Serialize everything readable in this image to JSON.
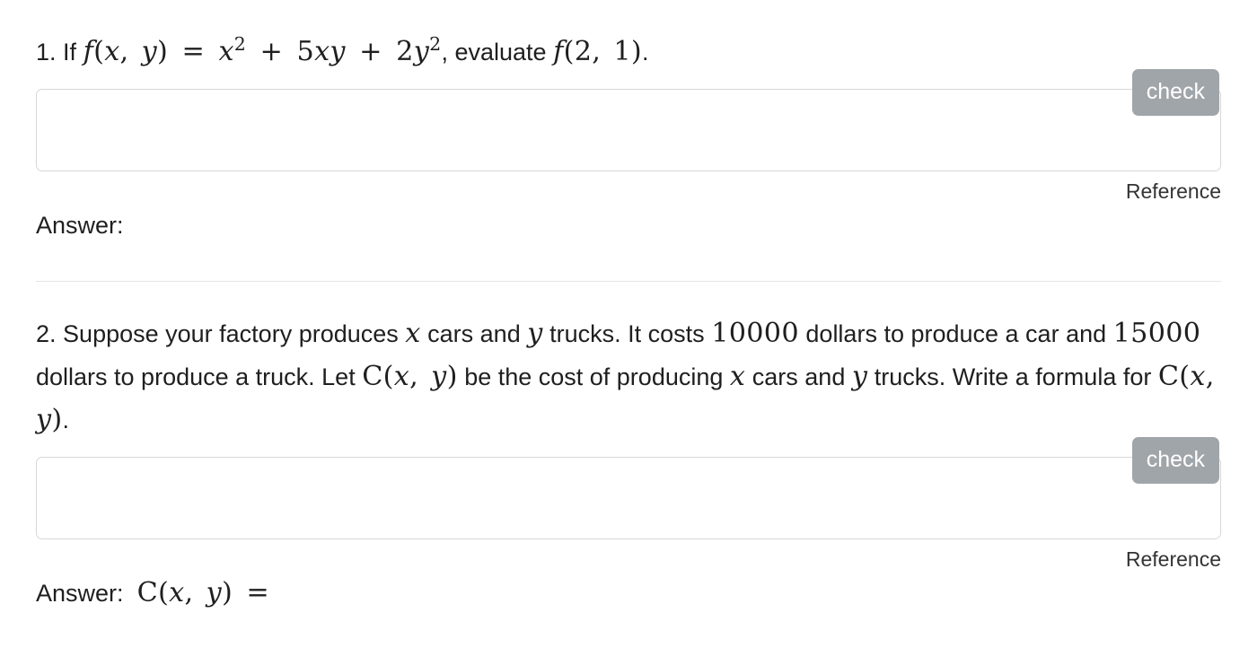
{
  "questions": [
    {
      "number": "1.",
      "lead_text": "If",
      "formula_inline": "f(x, y) = x² + 5xy + 2y²",
      "mid_text": ", evaluate",
      "formula_tail": "f(2, 1)",
      "trailing_text": ".",
      "input": {
        "value": "",
        "placeholder": ""
      },
      "check_label": "check",
      "reference_label": "Reference",
      "answer_label": "Answer:",
      "answer_formula": ""
    },
    {
      "number": "2.",
      "body_line_1_a": "Suppose your factory produces",
      "body_var_x": "x",
      "body_line_1_b": "cars and",
      "body_var_y": "y",
      "body_line_1_c": "trucks. It costs",
      "cost_car": "10000",
      "body_line_1_d": "dollars to produce a car and",
      "cost_truck": "15000",
      "body_line_1_e": "dollars to produce a truck. Let",
      "cost_function": "C(x, y)",
      "body_line_1_f": "be the cost of producing",
      "body_var_x2": "x",
      "body_line_1_g": "cars and",
      "body_var_y2": "y",
      "body_line_1_h": "trucks. Write a formula for",
      "cost_function_2": "C(x, y)",
      "body_line_1_i": ".",
      "input": {
        "value": "",
        "placeholder": ""
      },
      "check_label": "check",
      "reference_label": "Reference",
      "answer_label": "Answer:",
      "answer_formula": "C(x, y) ="
    }
  ],
  "colors": {
    "check_button_bg": "#a0a5a9",
    "check_button_text": "#ffffff",
    "input_border": "#d6d7da",
    "divider": "#e6e6e6",
    "text": "#1f1f1f",
    "page_bg": "#ffffff"
  }
}
